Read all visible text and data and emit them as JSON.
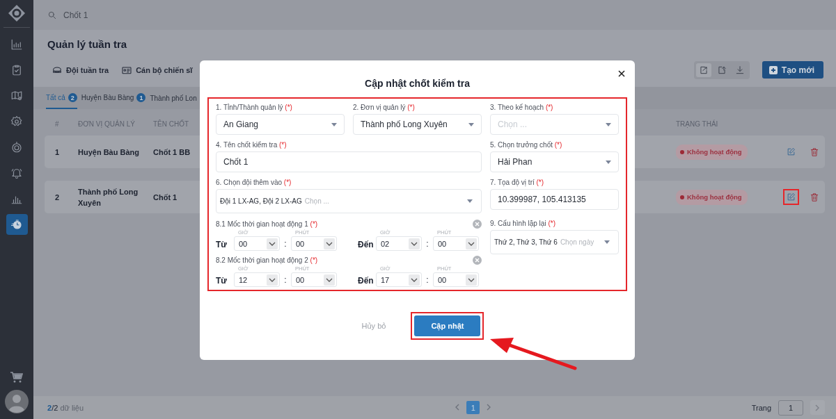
{
  "search": {
    "value": "Chốt 1"
  },
  "sidebar": {
    "items": [
      {
        "selected": false
      },
      {
        "selected": false
      },
      {
        "selected": false
      },
      {
        "selected": false
      },
      {
        "selected": false
      },
      {
        "selected": false
      },
      {
        "selected": false
      },
      {
        "selected": true
      }
    ]
  },
  "page_title": "Quản lý tuần tra",
  "view_tabs": [
    {
      "label": "Đội tuần tra"
    },
    {
      "label": "Cán bộ chiến sĩ"
    }
  ],
  "create_button": "Tạo mới",
  "filter_tabs": [
    {
      "label": "Tất cả",
      "count": "2",
      "selected": true
    },
    {
      "label": "Huyện Bàu Bàng",
      "count": "1",
      "selected": false
    },
    {
      "label": "Thành phố Lon",
      "selected": false
    }
  ],
  "table": {
    "columns": [
      "#",
      "ĐƠN VỊ QUẢN LÝ",
      "TÊN CHỐT",
      "TRẠNG THÁI"
    ],
    "rows": [
      {
        "index": "1",
        "unit": "Huyện Bàu Bàng",
        "name": "Chốt 1 BB",
        "status": "Không hoạt động",
        "edit_highlighted": false
      },
      {
        "index": "2",
        "unit": "Thành phố Long Xuyên",
        "name": "Chốt 1",
        "status": "Không hoạt động",
        "edit_highlighted": true
      }
    ]
  },
  "footer": {
    "shown": "2",
    "total": "/2",
    "label": "dữ liệu",
    "pages": [
      {
        "label": "1",
        "selected": true
      }
    ],
    "page_label": "Trang",
    "page_value": "1"
  },
  "modal": {
    "title": "Cập nhật chốt kiểm tra",
    "fields": [
      {
        "label": "1. Tỉnh/Thành quản lý",
        "mark": "(*)",
        "kind": "select",
        "value": "An Giang",
        "disabled": false
      },
      {
        "label": "2. Đơn vị quản lý",
        "mark": "(*)",
        "kind": "select",
        "value": "Thành phố Long Xuyên",
        "disabled": false
      },
      {
        "label": "3. Theo kế hoạch",
        "mark": "(*)",
        "kind": "select",
        "placeholder": "Chọn ...",
        "disabled": true
      },
      {
        "label": "4. Tên chốt kiểm tra",
        "mark": "(*)",
        "kind": "text",
        "value": "Chốt 1",
        "disabled": false
      },
      {
        "label": "5. Chọn trưởng chốt",
        "mark": "(*)",
        "kind": "select",
        "value": "Hải Phan",
        "disabled": false
      },
      {
        "label": "6. Chọn đội thêm vào",
        "mark": "(*)",
        "kind": "multi",
        "value": "Đội 1 LX-AG, Đội 2 LX-AG",
        "placeholder": "Chọn ...",
        "disabled": false
      },
      {
        "label": "7. Tọa độ vị trí",
        "mark": "(*)",
        "kind": "text",
        "value": "10.399987, 105.413135",
        "disabled": false
      },
      {
        "label": "9. Cấu hình lặp lại",
        "mark": "(*)",
        "kind": "multi",
        "value": "Thứ 2, Thứ 3, Thứ 6",
        "placeholder": "Chọn ngày",
        "disabled": false
      }
    ],
    "time_slots": [
      {
        "label": "8.1 Mốc thời gian hoạt động 1",
        "mark": "(*)",
        "from_label": "Từ",
        "to_label": "Đến",
        "from": {
          "hour_caption": "GIỜ",
          "hour": "00",
          "separator": ":",
          "minute_caption": "PHÚT",
          "minute": "00"
        },
        "to": {
          "hour_caption": "GIỜ",
          "hour": "02",
          "separator": ":",
          "minute_caption": "PHÚT",
          "minute": "00"
        }
      },
      {
        "label": "8.2 Mốc thời gian hoạt động 2",
        "mark": "(*)",
        "from_label": "Từ",
        "to_label": "Đến",
        "from": {
          "hour_caption": "GIỜ",
          "hour": "12",
          "separator": ":",
          "minute_caption": "PHÚT",
          "minute": "00"
        },
        "to": {
          "hour_caption": "GIỜ",
          "hour": "17",
          "separator": ":",
          "minute_caption": "PHÚT",
          "minute": "00"
        }
      }
    ],
    "cancel": "Hủy bỏ",
    "submit": "Cập nhật",
    "submit_highlighted": true
  }
}
